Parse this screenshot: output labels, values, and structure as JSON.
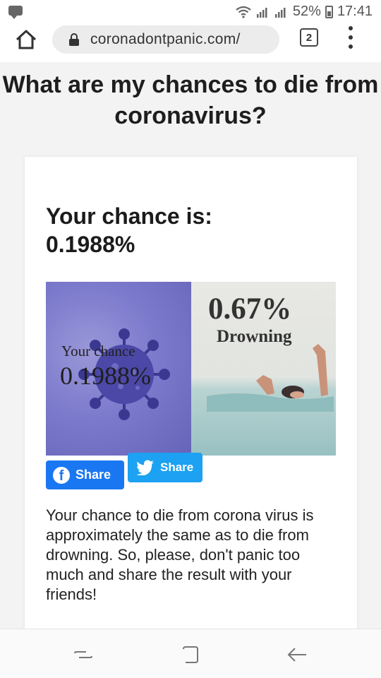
{
  "status_bar": {
    "battery_percent": "52%",
    "time": "17:41",
    "icons": [
      "notification-icon",
      "wifi-icon",
      "signal-icon",
      "battery-icon"
    ]
  },
  "browser": {
    "url": "coronadontpanic.com/",
    "tab_count": "2",
    "icons": [
      "home-icon",
      "lock-icon",
      "tabs-icon",
      "menu-icon"
    ]
  },
  "page": {
    "title": "What are my chances to die from coronavirus?",
    "result_label": "Your chance is:",
    "result_value": "0.1988%",
    "image": {
      "left_label": "Your chance",
      "left_value": "0.1988%",
      "right_value": "0.67%",
      "right_label": "Drowning"
    },
    "share": {
      "facebook_label": "Share",
      "twitter_label": "Share"
    },
    "result_text": "Your chance to die from corona virus is approximately the same as to die from drowning. So, please, don't panic too much and share the result with your friends!"
  },
  "nav_bar": {
    "icons": [
      "recent-apps-icon",
      "home-button-icon",
      "back-icon"
    ]
  },
  "colors": {
    "facebook": "#1a77f2",
    "twitter": "#1da1f2",
    "virus_bg": "#7c7acc"
  }
}
